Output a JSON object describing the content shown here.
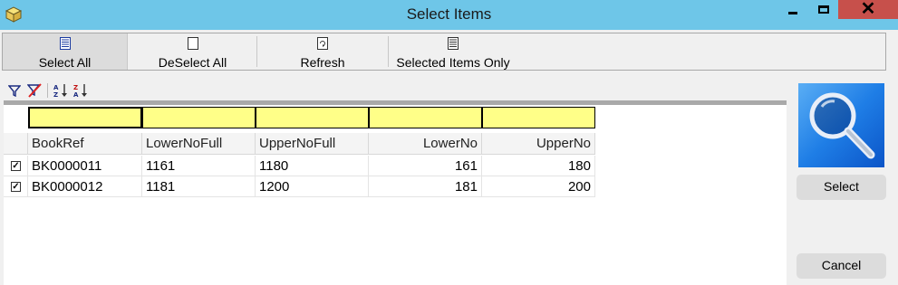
{
  "window": {
    "title": "Select Items",
    "icon": "package-icon"
  },
  "toolbar": {
    "buttons": [
      {
        "label": "Select All",
        "icon": "list-icon",
        "active": true
      },
      {
        "label": "DeSelect All",
        "icon": "blank-page-icon"
      },
      {
        "label": "Refresh",
        "icon": "refresh-page-icon"
      },
      {
        "label": "Selected Items Only",
        "icon": "selected-list-icon"
      }
    ]
  },
  "filterbar": {
    "icons": [
      "filter-icon",
      "clear-filter-icon",
      "sort-ascending-icon",
      "sort-descending-icon"
    ]
  },
  "grid": {
    "columns": [
      "BookRef",
      "LowerNoFull",
      "UpperNoFull",
      "LowerNo",
      "UpperNo"
    ],
    "rows": [
      {
        "checked": true,
        "cells": [
          "BK0000011",
          "1161",
          "1180",
          "161",
          "180"
        ]
      },
      {
        "checked": true,
        "cells": [
          "BK0000012",
          "1181",
          "1200",
          "181",
          "200"
        ]
      }
    ],
    "filter_color": "#ffff88"
  },
  "side": {
    "select_label": "Select",
    "cancel_label": "Cancel",
    "icon": "magnifier-icon"
  },
  "colors": {
    "titlebar": "#6ec6e8",
    "close": "#c7504b",
    "search_bg": "#1f7ee6"
  }
}
